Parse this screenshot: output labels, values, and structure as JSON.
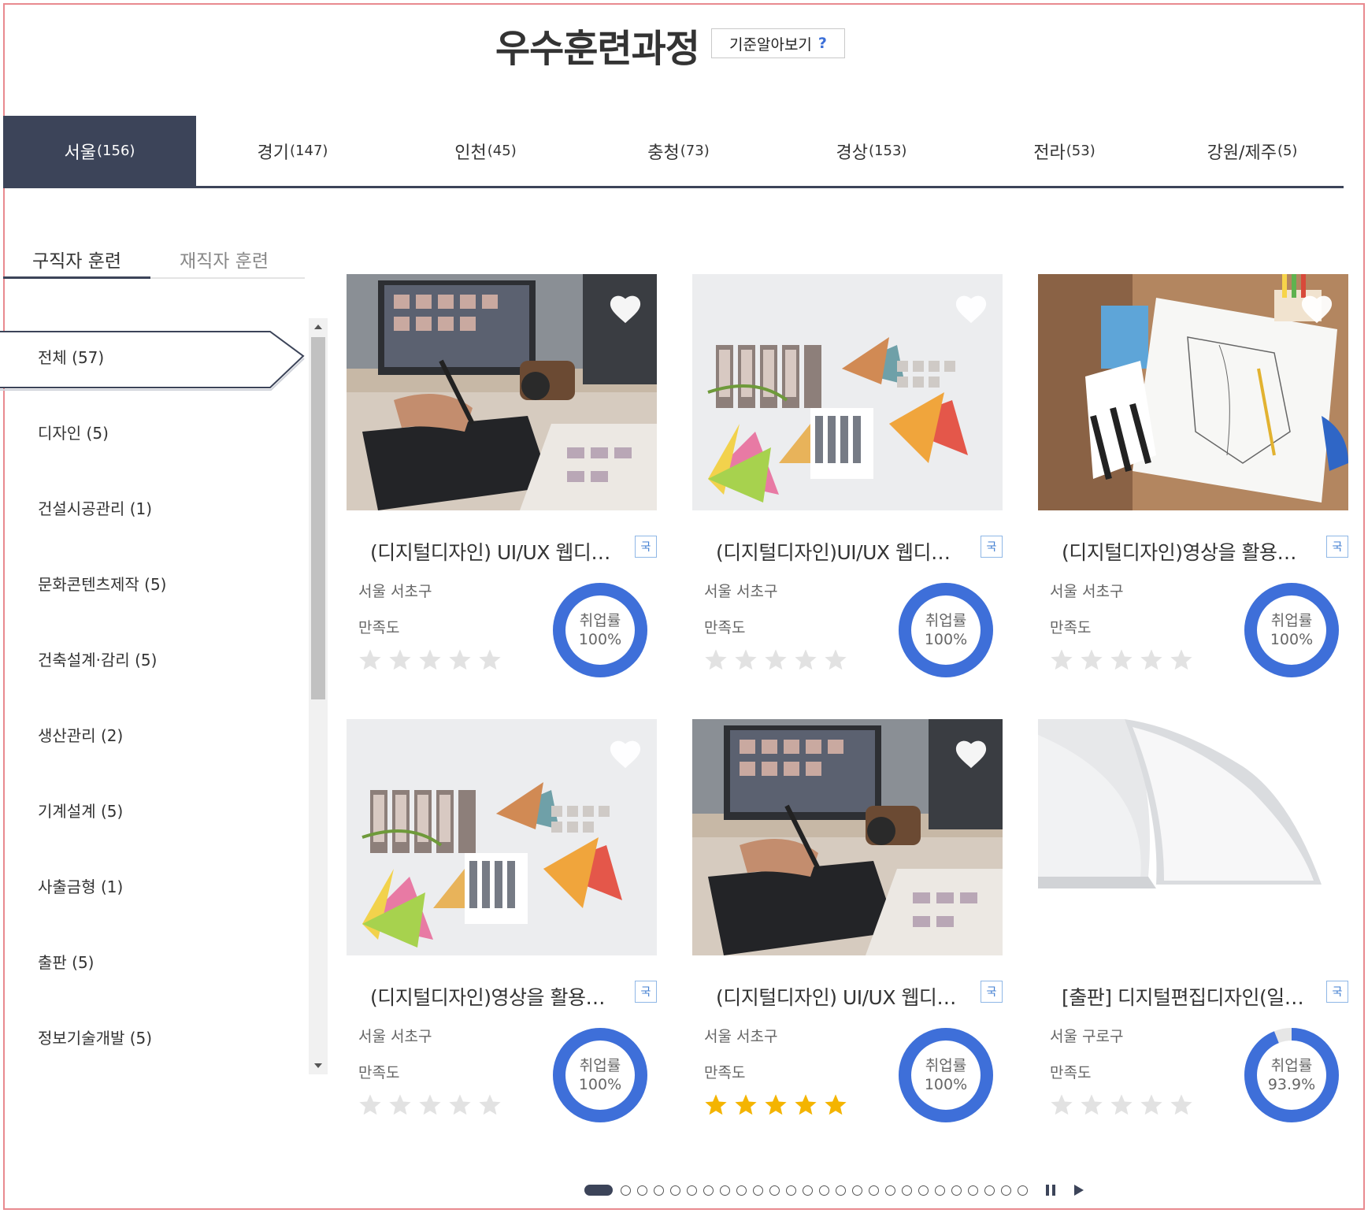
{
  "header": {
    "title": "우수훈련과정",
    "criteria_label": "기준알아보기",
    "criteria_icon": "?"
  },
  "region_tabs": [
    {
      "label": "서울",
      "count": "(156)",
      "active": true
    },
    {
      "label": "경기",
      "count": "(147)",
      "active": false
    },
    {
      "label": "인천",
      "count": "(45)",
      "active": false
    },
    {
      "label": "충청",
      "count": "(73)",
      "active": false
    },
    {
      "label": "경상",
      "count": "(153)",
      "active": false
    },
    {
      "label": "전라",
      "count": "(53)",
      "active": false
    },
    {
      "label": "강원/제주",
      "count": "(5)",
      "active": false
    }
  ],
  "sub_tabs": [
    {
      "label": "구직자 훈련",
      "active": true
    },
    {
      "label": "재직자 훈련",
      "active": false
    }
  ],
  "categories": [
    {
      "label": "전체 (57)",
      "active": true
    },
    {
      "label": "디자인 (5)",
      "active": false
    },
    {
      "label": "건설시공관리 (1)",
      "active": false
    },
    {
      "label": "문화콘텐츠제작 (5)",
      "active": false
    },
    {
      "label": "건축설계·감리 (5)",
      "active": false
    },
    {
      "label": "생산관리 (2)",
      "active": false
    },
    {
      "label": "기계설계 (5)",
      "active": false
    },
    {
      "label": "사출금형 (1)",
      "active": false
    },
    {
      "label": "출판 (5)",
      "active": false
    },
    {
      "label": "정보기술개발 (5)",
      "active": false
    }
  ],
  "cards": [
    {
      "image": "designer-tablet-photo",
      "title": "(디지털디자인) UI/UX 웹디자인 실무자 양성과정",
      "badge": "국",
      "location": "서울 서초구",
      "satisfaction_label": "만족도",
      "rating": 0,
      "rate_label": "취업률",
      "rate_value": "100%",
      "rate": 1.0
    },
    {
      "image": "color-swatches-photo",
      "title": "(디지털디자인)UI/UX 웹디자인 반응형 웹 실무",
      "badge": "국",
      "location": "서울 서초구",
      "satisfaction_label": "만족도",
      "rating": 0,
      "rate_label": "취업률",
      "rate_value": "100%",
      "rate": 1.0
    },
    {
      "image": "pattern-drawing-photo",
      "title": "(디지털디자인)영상을 활용한 패션디자인 실무",
      "badge": "국",
      "location": "서울 서초구",
      "satisfaction_label": "만족도",
      "rating": 0,
      "rate_label": "취업률",
      "rate_value": "100%",
      "rate": 1.0
    },
    {
      "image": "color-swatches-photo",
      "title": "(디지털디자인)영상을 활용한 광고디자인 실무",
      "badge": "국",
      "location": "서울 서초구",
      "satisfaction_label": "만족도",
      "rating": 0,
      "rate_label": "취업률",
      "rate_value": "100%",
      "rate": 1.0
    },
    {
      "image": "designer-tablet-photo",
      "title": "(디지털디자인) UI/UX 웹디자인 실무자 양성과정",
      "badge": "국",
      "location": "서울 서초구",
      "satisfaction_label": "만족도",
      "rating": 5,
      "rate_label": "취업률",
      "rate_value": "100%",
      "rate": 1.0
    },
    {
      "image": "open-book-photo",
      "title": "[출판] 디지털편집디자인(일러스트,인디자인)",
      "badge": "국",
      "location": "서울 구로구",
      "satisfaction_label": "만족도",
      "rating": 0,
      "rate_label": "취업률",
      "rate_value": "93.9%",
      "rate": 0.939
    }
  ],
  "pagination": {
    "total": 26,
    "current": 1
  },
  "colors": {
    "primary_dark": "#3c4459",
    "ring_blue": "#3e6fd9",
    "ring_track": "#e6e6e6",
    "star_on": "#f4b400",
    "star_off": "#e2e2e2",
    "badge_blue": "#3f7dd1"
  }
}
